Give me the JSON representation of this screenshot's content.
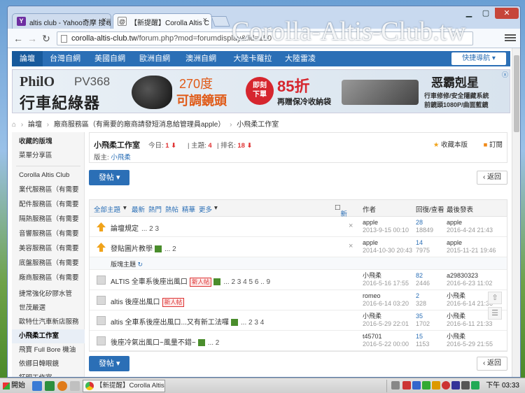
{
  "browser": {
    "tabs": [
      {
        "label": "altis club - Yahoo奇摩 搜尋",
        "icon": "Y"
      },
      {
        "label": "【新提醒】Corolla Altis C",
        "icon": "@"
      }
    ],
    "url_host": "corolla-altis-club.tw",
    "url_path": "/forum.php?mod=forumdisplay&fid=150",
    "watermark": "Corolla-Altis-Club.tw"
  },
  "site_nav": {
    "items": [
      "論壇",
      "台灣自網",
      "美國自網",
      "歐洲自網",
      "澳洲自網",
      "大陸卡羅拉",
      "大陸雷凌"
    ],
    "quick": "快捷導航"
  },
  "banner": {
    "brand": "PhilO",
    "model": "PV368",
    "product": "行車紀綠器",
    "deg1": "270度",
    "deg2": "可調鏡頭",
    "promo_badge1": "即刻",
    "promo_badge2": "下單",
    "promo_discount": "85折",
    "promo_gift": "再贈保冷收納袋",
    "right_title": "恶霸剋星",
    "right_line1": "行車修修/安全隱藏系統",
    "right_line2": "前鏡頭1080P/曲面藍鏡",
    "close": "ⓧ"
  },
  "breadcrumb": [
    "論壇",
    "廠商服務區（有需要的廠商請發短消息給管理員apple）",
    "小飛柔工作室"
  ],
  "sidebar": {
    "items": [
      {
        "label": "收藏的版塊",
        "head": true
      },
      {
        "label": "菜單分享區",
        "head": false
      },
      {
        "label": "Corolla Altis Club",
        "head": false
      },
      {
        "label": "業代服務區（有需要",
        "head": false
      },
      {
        "label": "配件服務區（有需要",
        "head": false
      },
      {
        "label": "隔熱服務區（有需要",
        "head": false
      },
      {
        "label": "音響服務區（有需要",
        "head": false
      },
      {
        "label": "美容服務區（有需要",
        "head": false
      },
      {
        "label": "底盤服務區（有需要",
        "head": false
      },
      {
        "label": "廠商服務區（有需要",
        "head": false
      },
      {
        "label": "捷常強化矽膠水管",
        "head": false
      },
      {
        "label": "世茂嚴選",
        "head": false
      },
      {
        "label": "歐特仕汽車新店服務",
        "head": false
      },
      {
        "label": "小飛柔工作室",
        "head": false,
        "current": true
      },
      {
        "label": "飛寶 Full Bore 機油",
        "head": false
      },
      {
        "label": "依娜日韓眼鏡",
        "head": false
      },
      {
        "label": "鉦明工作室",
        "head": false
      }
    ]
  },
  "forum": {
    "title": "小飛柔工作室",
    "today_label": "今日:",
    "today": "1",
    "topics_label": "主題:",
    "topics": "4",
    "rank_label": "排名:",
    "rank": "18",
    "moderator_label": "版主:",
    "moderator": "小飛柔",
    "fav": "收藏本版",
    "sub": "訂閱",
    "post": "發帖",
    "back": "返回"
  },
  "list": {
    "filters": [
      "全部主題",
      "最新",
      "熱門",
      "熱帖",
      "精華",
      "更多"
    ],
    "new_label": "新窗",
    "col_author": "作者",
    "col_stats": "回復/查看",
    "col_last": "最後發表",
    "sort_label": "版塊主題",
    "rows": [
      {
        "title": "論壇規定",
        "pages": "... 2 3",
        "tag": "",
        "icon": "up",
        "author": "apple",
        "adate": "2013-9-15 00:10",
        "replies": "28",
        "views": "18849",
        "last": "apple",
        "ldate": "2016-4-24 21:43",
        "x": true
      },
      {
        "title": "發貼圖片教學",
        "pages": "... 2",
        "tag": "",
        "icon": "up",
        "author": "apple",
        "adate": "2014-10-30 20:43",
        "replies": "14",
        "views": "7975",
        "last": "apple",
        "ldate": "2015-11-21 19:46",
        "x": true
      },
      {
        "title": "ALTIS 全車系後座出風口",
        "pages": "... 2 3 4 5 6 .. 9",
        "tag": "新人帖",
        "icon": "doc",
        "author": "小飛柔",
        "adate": "2016-5-16 17:55",
        "replies": "82",
        "views": "2446",
        "last": "a29830323",
        "ldate": "2016-6-23 11:02",
        "x": false
      },
      {
        "title": "altis 後座出風口",
        "pages": "",
        "tag": "新人帖",
        "icon": "doc",
        "author": "romeo",
        "adate": "2016-6-14 03:20",
        "replies": "2",
        "views": "328",
        "last": "小飛柔",
        "ldate": "2016-6-14 21:36",
        "x": false
      },
      {
        "title": "altis 全車系後座出風口...又有新工法囉",
        "pages": "... 2 3 4",
        "tag": "",
        "icon": "doc",
        "author": "小飛柔",
        "adate": "2016-5-29 22:01",
        "replies": "35",
        "views": "1702",
        "last": "小飛柔",
        "ldate": "2016-6-11 21:33",
        "x": false
      },
      {
        "title": "後座冷氣出風口~風量不錯~",
        "pages": "... 2",
        "tag": "",
        "icon": "doc",
        "author": "t45701",
        "adate": "2016-5-22 00:00",
        "replies": "15",
        "views": "1153",
        "last": "小飛柔",
        "ldate": "2016-5-29 21:55",
        "x": false
      }
    ]
  },
  "taskbar": {
    "start": "開始",
    "task": "【新提醒】Corolla Altis ...",
    "clock": "下午 03:33"
  }
}
